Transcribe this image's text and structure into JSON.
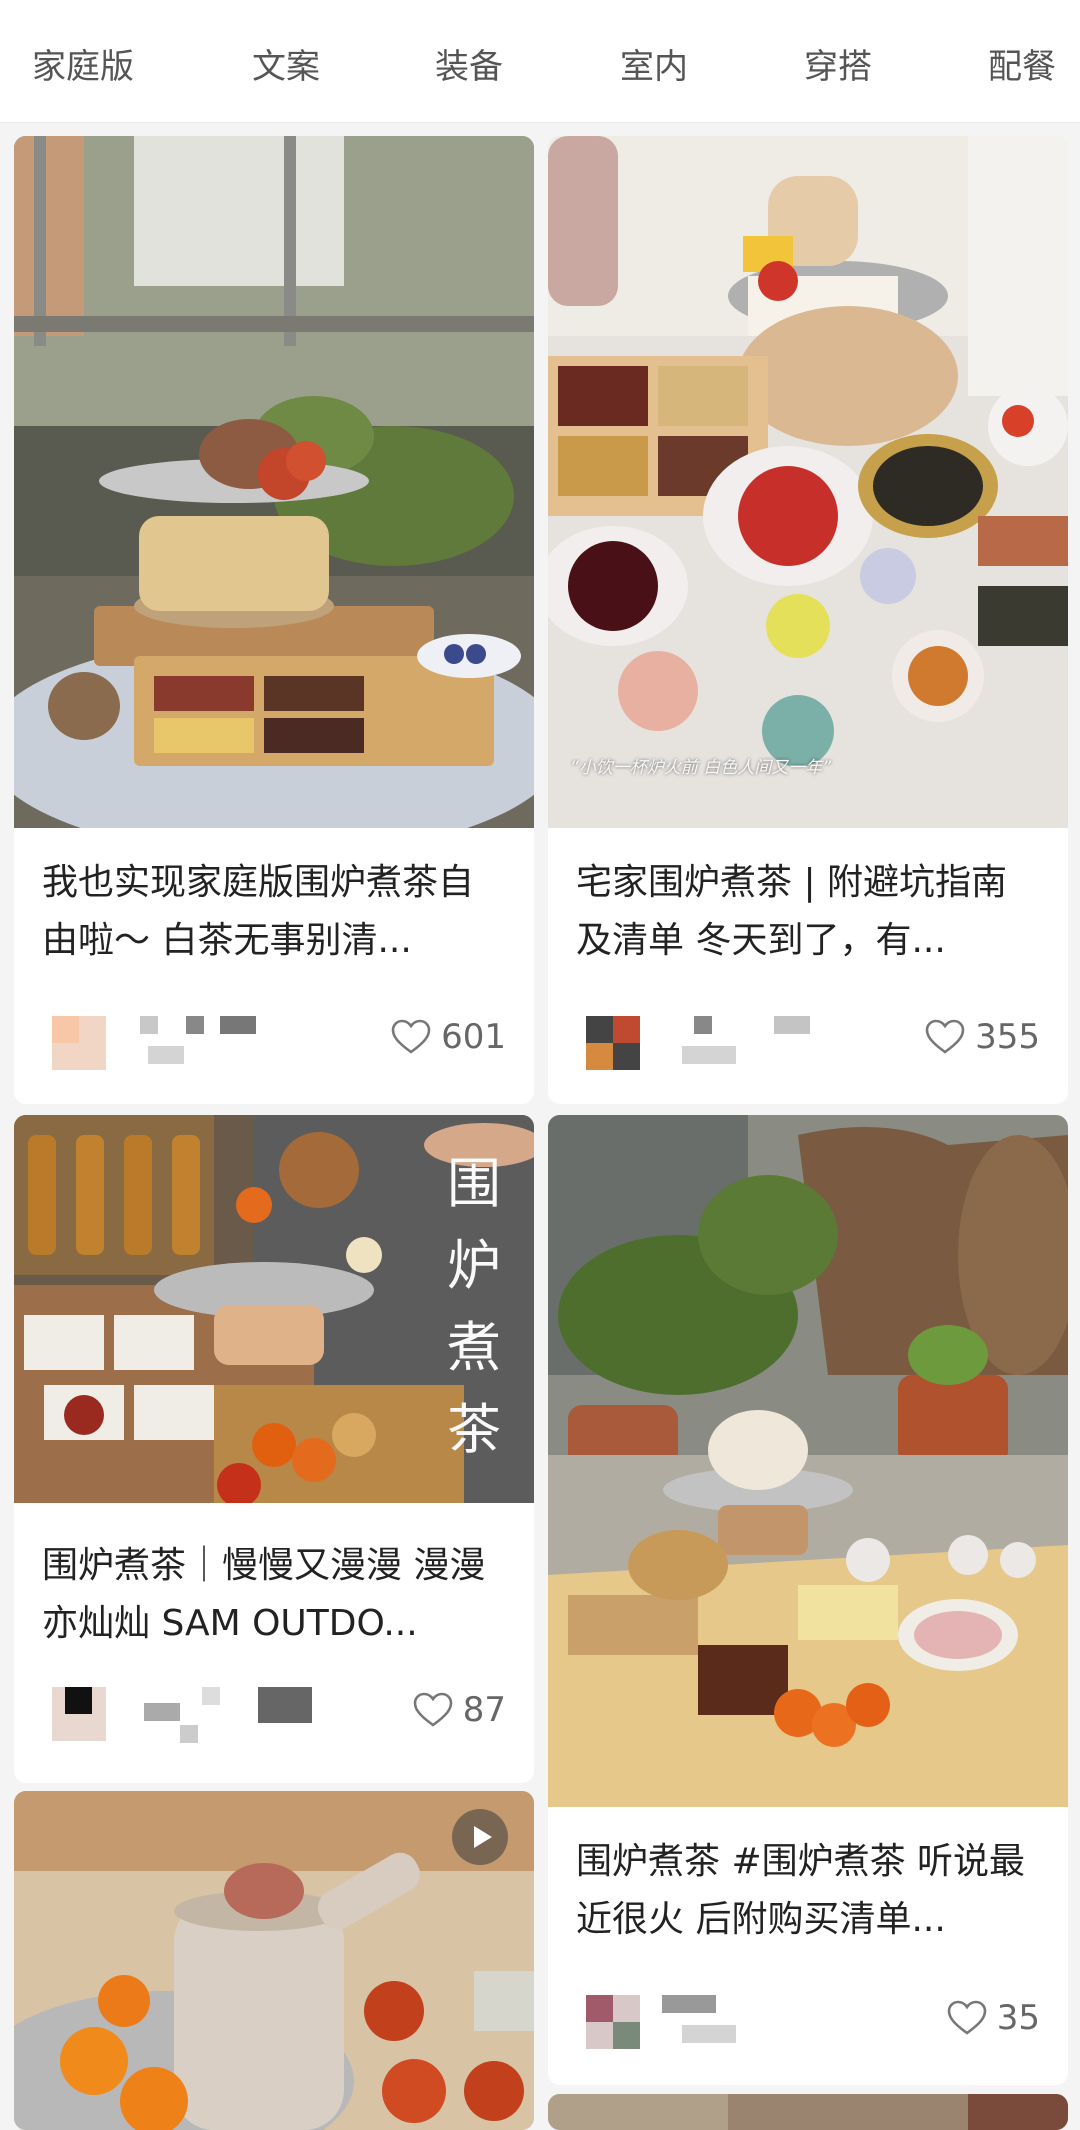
{
  "tabs": [
    "家庭版",
    "文案",
    "装备",
    "室内",
    "穿搭",
    "配餐"
  ],
  "cards": [
    {
      "title": "我也实现家庭版围炉煮茶自由啦～ 白茶无事别清...",
      "likes": "601"
    },
    {
      "title": "宅家围炉煮茶 | 附避坑指南及清单 冬天到了，有...",
      "likes": "355",
      "photo_caption": "“小饮一杯炉火前 白色人间又一年”"
    },
    {
      "title": "围炉煮茶｜慢慢又漫漫 漫漫亦灿灿 SAM OUTDO...",
      "likes": "87",
      "photo_text": "围炉煮茶"
    },
    {
      "title": "围炉煮茶 #围炉煮茶  听说最近很火 后附购买清单...",
      "likes": "35"
    }
  ],
  "icons": {
    "likes": "heart-outline-icon",
    "video": "play-icon"
  },
  "colors": {
    "background": "#f4f4f4",
    "card": "#ffffff",
    "text": "#222222",
    "muted": "#666666"
  }
}
